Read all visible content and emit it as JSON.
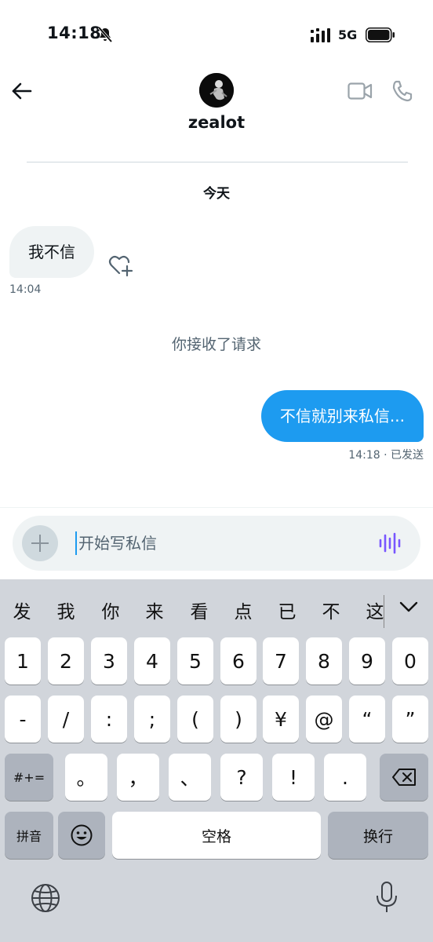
{
  "status_bar": {
    "time": "14:18",
    "network": "5G"
  },
  "header": {
    "username": "zealot"
  },
  "conversation": {
    "date_label": "今天",
    "messages": [
      {
        "direction": "in",
        "text": "我不信",
        "time": "14:04"
      },
      {
        "direction": "system",
        "text": "你接收了请求"
      },
      {
        "direction": "out",
        "text": "不信就别来私信...",
        "time": "14:18 · 已发送"
      }
    ]
  },
  "composer": {
    "placeholder": "开始写私信",
    "value": ""
  },
  "keyboard": {
    "candidates": [
      "发",
      "我",
      "你",
      "来",
      "看",
      "点",
      "已",
      "不",
      "这"
    ],
    "row_numbers": [
      "1",
      "2",
      "3",
      "4",
      "5",
      "6",
      "7",
      "8",
      "9",
      "0"
    ],
    "row_symbols": [
      "-",
      "/",
      ":",
      ";",
      "(",
      ")",
      "¥",
      "@",
      "“",
      "”"
    ],
    "row_punct": [
      "。",
      "，",
      "、",
      "?",
      "!",
      "."
    ],
    "mode_key": "#+=",
    "ime_key": "拼音",
    "space_key": "空格",
    "return_key": "换行"
  },
  "colors": {
    "accent": "#1d9bf0",
    "bubble_in": "#eff3f4",
    "muted_text": "#536471",
    "keyboard_bg": "#d1d5db",
    "voice_icon": "#7856ff"
  },
  "icons": [
    "bell-slash-icon",
    "signal-icon",
    "battery-icon",
    "back-arrow-icon",
    "video-call-icon",
    "phone-call-icon",
    "add-reaction-icon",
    "plus-icon",
    "voice-message-icon",
    "chevron-down-icon",
    "backspace-icon",
    "emoji-icon",
    "globe-icon",
    "microphone-icon"
  ]
}
